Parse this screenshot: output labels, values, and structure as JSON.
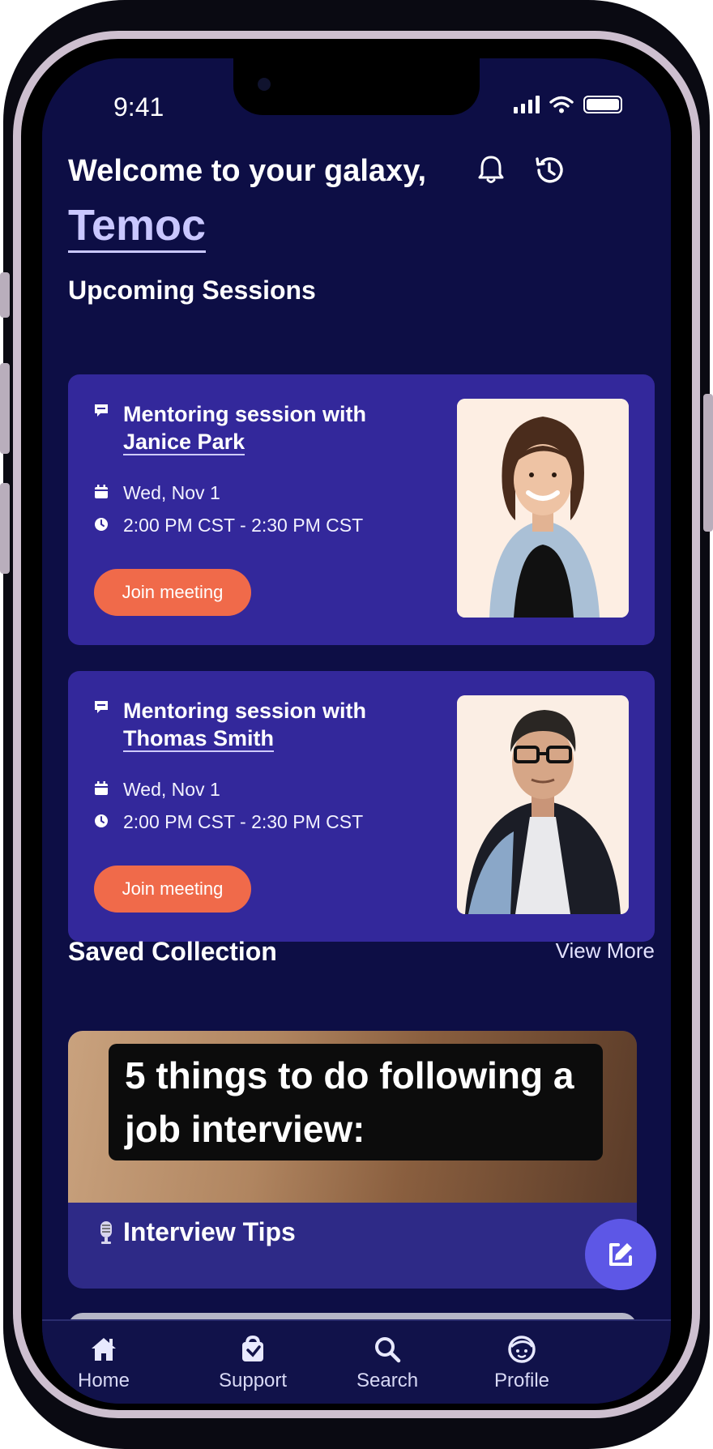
{
  "status_bar": {
    "time": "9:41"
  },
  "header": {
    "welcome": "Welcome to your galaxy,",
    "username": "Temoc",
    "icons": [
      "bell-icon",
      "history-icon"
    ]
  },
  "upcoming": {
    "title": "Upcoming Sessions",
    "sessions": [
      {
        "title_prefix": "Mentoring session with",
        "mentor": "Janice Park",
        "date": "Wed, Nov 1",
        "time": "2:00 PM CST - 2:30 PM CST",
        "button": "Join meeting"
      },
      {
        "title_prefix": "Mentoring session with",
        "mentor": "Thomas Smith",
        "date": "Wed, Nov 1",
        "time": "2:00 PM CST - 2:30 PM CST",
        "button": "Join meeting"
      }
    ]
  },
  "saved": {
    "title": "Saved Collection",
    "view_more": "View More",
    "card": {
      "caption_line1": "5 things to do following a",
      "caption_line2": "job interview:",
      "label": "Interview Tips"
    }
  },
  "tabbar": {
    "items": [
      {
        "label": "Home",
        "icon": "home-icon"
      },
      {
        "label": "Support",
        "icon": "support-icon"
      },
      {
        "label": "Search",
        "icon": "search-icon"
      },
      {
        "label": "Profile",
        "icon": "profile-icon"
      }
    ]
  },
  "colors": {
    "background": "#0d0e45",
    "card": "#33289b",
    "accent_button": "#f06a4a",
    "fab": "#5d57e6",
    "highlight_name": "#c9c7ff"
  }
}
